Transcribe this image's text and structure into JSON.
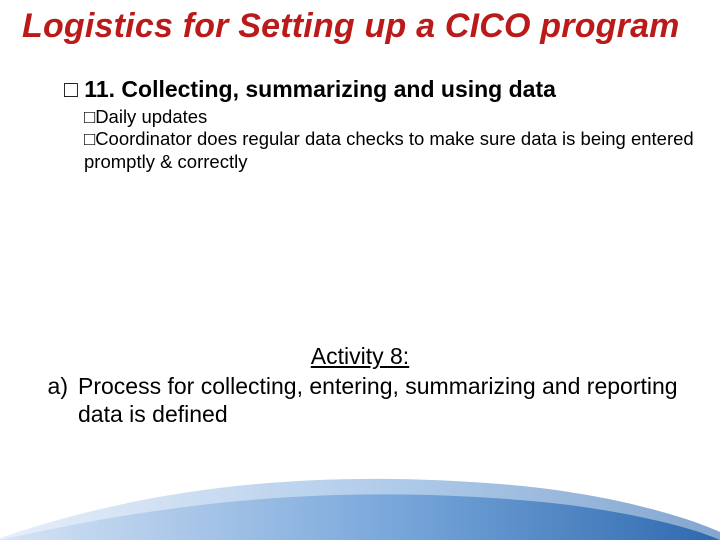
{
  "title": "Logistics for Setting up a CICO program",
  "bullet_glyph": "□",
  "heading": {
    "number": "11.",
    "text": "Collecting, summarizing and using data"
  },
  "sub_items": [
    "Daily updates",
    "Coordinator does regular data checks to make sure data is being entered promptly & correctly"
  ],
  "activity": {
    "title": "Activity 8:",
    "items": [
      {
        "marker": "a)",
        "text": "Process for collecting, entering, summarizing and reporting data is defined"
      }
    ]
  }
}
